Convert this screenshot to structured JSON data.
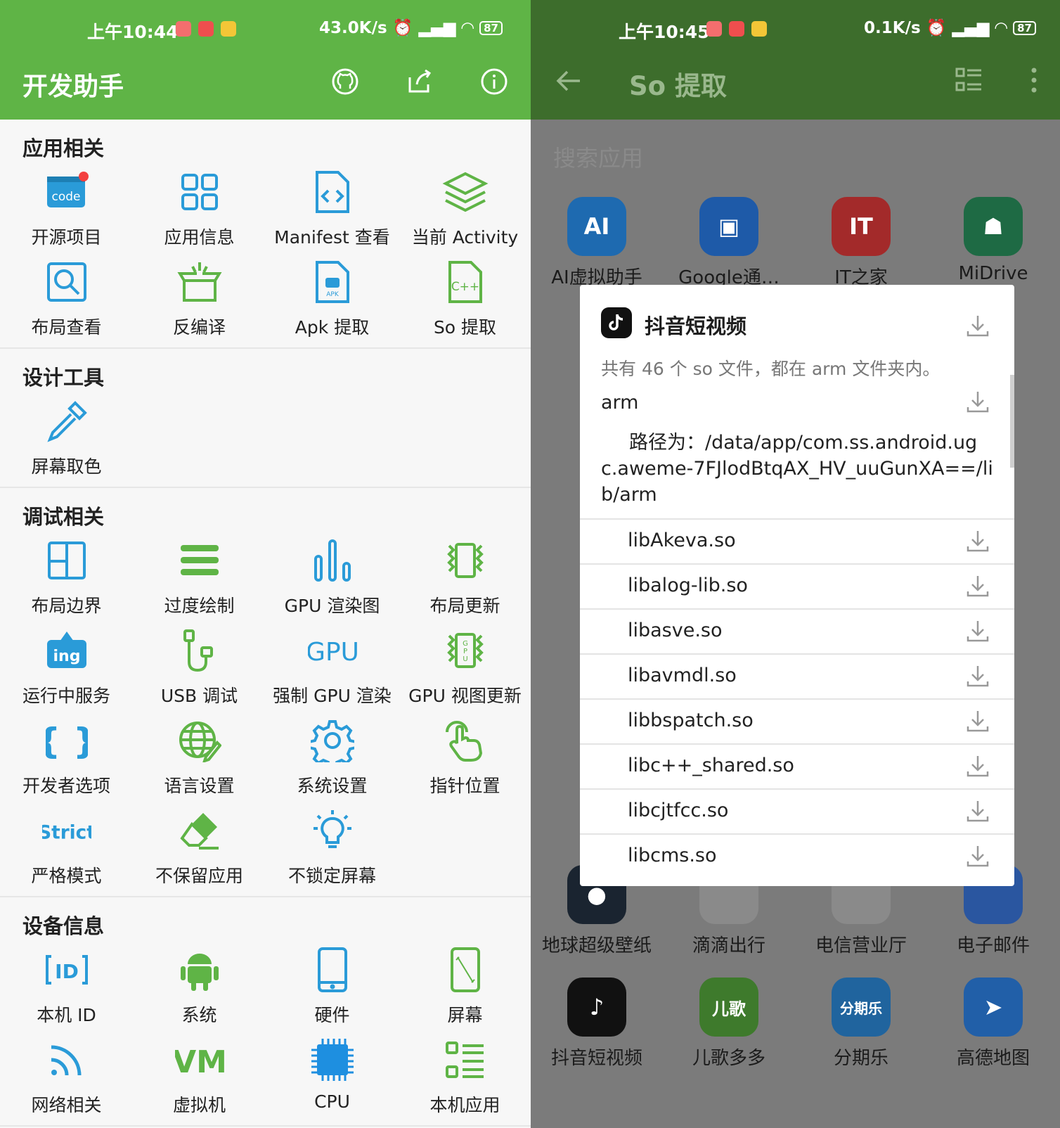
{
  "left": {
    "status": {
      "time": "上午10:44",
      "speed": "43.0K/s",
      "battery": "87"
    },
    "appbar": {
      "title": "开发助手"
    },
    "sections": [
      {
        "title": "应用相关",
        "items": [
          {
            "label": "开源项目",
            "icon": "code-icon"
          },
          {
            "label": "应用信息",
            "icon": "app-info-icon"
          },
          {
            "label": "Manifest 查看",
            "icon": "manifest-icon"
          },
          {
            "label": "当前 Activity",
            "icon": "layers-icon"
          },
          {
            "label": "布局查看",
            "icon": "layout-inspect-icon"
          },
          {
            "label": "反编译",
            "icon": "decompile-icon"
          },
          {
            "label": "Apk 提取",
            "icon": "apk-icon"
          },
          {
            "label": "So 提取",
            "icon": "so-file-icon"
          }
        ]
      },
      {
        "title": "设计工具",
        "items": [
          {
            "label": "屏幕取色",
            "icon": "eyedropper-icon"
          }
        ]
      },
      {
        "title": "调试相关",
        "items": [
          {
            "label": "布局边界",
            "icon": "layout-bounds-icon"
          },
          {
            "label": "过度绘制",
            "icon": "overdraw-icon"
          },
          {
            "label": "GPU 渲染图",
            "icon": "gpu-bars-icon"
          },
          {
            "label": "布局更新",
            "icon": "layout-update-icon"
          },
          {
            "label": "运行中服务",
            "icon": "running-services-icon"
          },
          {
            "label": "USB 调试",
            "icon": "usb-icon"
          },
          {
            "label": "强制 GPU 渲染",
            "icon": "gpu-text-icon"
          },
          {
            "label": "GPU 视图更新",
            "icon": "gpu-view-update-icon"
          },
          {
            "label": "开发者选项",
            "icon": "braces-icon"
          },
          {
            "label": "语言设置",
            "icon": "globe-edit-icon"
          },
          {
            "label": "系统设置",
            "icon": "gear-icon"
          },
          {
            "label": "指针位置",
            "icon": "pointer-touch-icon"
          },
          {
            "label": "严格模式",
            "icon": "strict-icon"
          },
          {
            "label": "不保留应用",
            "icon": "eraser-icon"
          },
          {
            "label": "不锁定屏幕",
            "icon": "bulb-icon"
          }
        ]
      },
      {
        "title": "设备信息",
        "items": [
          {
            "label": "本机 ID",
            "icon": "id-icon"
          },
          {
            "label": "系统",
            "icon": "android-icon"
          },
          {
            "label": "硬件",
            "icon": "phone-icon"
          },
          {
            "label": "屏幕",
            "icon": "screen-icon"
          },
          {
            "label": "网络相关",
            "icon": "rss-icon"
          },
          {
            "label": "虚拟机",
            "icon": "vm-icon"
          },
          {
            "label": "CPU",
            "icon": "cpu-icon"
          },
          {
            "label": "本机应用",
            "icon": "app-list-icon"
          }
        ]
      }
    ]
  },
  "right": {
    "status": {
      "time": "上午10:45",
      "speed": "0.1K/s",
      "battery": "87"
    },
    "appbar": {
      "title": "So 提取"
    },
    "search": {
      "placeholder": "搜索应用"
    },
    "apps_top": [
      {
        "label": "AI虚拟助手",
        "color": "#1e88e5",
        "glyph": "AI"
      },
      {
        "label": "Google通…",
        "color": "#1a73e8",
        "glyph": "▣"
      },
      {
        "label": "IT之家",
        "color": "#d93636",
        "glyph": "IT"
      },
      {
        "label": "MiDrive",
        "color": "#2a8a57",
        "glyph": "☗"
      }
    ],
    "apps_bottom": [
      {
        "label": "地球超级壁纸",
        "color": "#1f2a3a",
        "glyph": "●"
      },
      {
        "label": "滴滴出行",
        "color": "#f5f5f5",
        "glyph": ""
      },
      {
        "label": "电信营业厅",
        "color": "#f5f5f5",
        "glyph": ""
      },
      {
        "label": "电子邮件",
        "color": "#2f6fd6",
        "glyph": ""
      },
      {
        "label": "抖音短视频",
        "color": "#111111",
        "glyph": "♪"
      },
      {
        "label": "儿歌多多",
        "color": "#5ba33a",
        "glyph": "儿歌"
      },
      {
        "label": "分期乐",
        "color": "#2f8bd9",
        "glyph": "分期乐"
      },
      {
        "label": "高德地图",
        "color": "#2e84e8",
        "glyph": "➤"
      }
    ],
    "dialog": {
      "title": "抖音短视频",
      "desc": "共有 46 个 so 文件，都在 arm 文件夹内。",
      "folder": "arm",
      "path": "路径为：/data/app/com.ss.android.ugc.aweme-7FJlodBtqAX_HV_uuGunXA==/lib/arm",
      "files": [
        "libAkeva.so",
        "libalog-lib.so",
        "libasve.so",
        "libavmdl.so",
        "libbspatch.so",
        "libc++_shared.so",
        "libcjtfcc.so",
        "libcms.so"
      ]
    }
  }
}
